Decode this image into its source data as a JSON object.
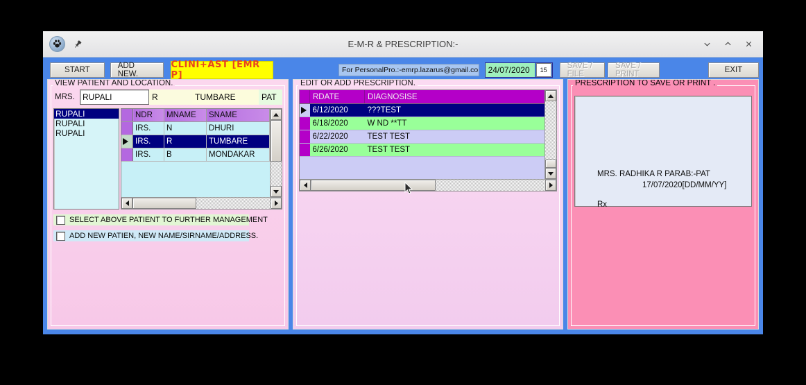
{
  "titlebar": {
    "title": "E-M-R & PRESCRIPTION:-",
    "app_icon": "paw-print-icon",
    "pin_icon": "pin-icon",
    "minimize_label": "⌄",
    "restore_label": "⌃",
    "close_label": "✕"
  },
  "toolbar": {
    "start_label": "START",
    "add_new_label": "ADD NEW.",
    "brand_label": "CLINI+AST [EMR P]",
    "brand_bg": "#ffff00",
    "brand_color": "#e8441d",
    "email_value": "For PersonalPro.:-emrp.lazarus@gmail.com",
    "date_value": "24/07/2020",
    "date_spin_value": "15",
    "save_file_label": "SAVE / FILE",
    "save_print_label": "SAVE / PRINT",
    "exit_label": "EXIT"
  },
  "left_panel": {
    "legend": "VIEW PATIENT AND LOCATION.",
    "name_prefix": "MRS.",
    "name_value": "RUPALI",
    "middle_initial": "R",
    "surname": "TUMBARE",
    "location": "PAT",
    "patient_list": [
      "RUPALI",
      "RUPALI",
      "RUPALI"
    ],
    "selected_list_index": 0,
    "grid_headers": [
      "NDR",
      "MNAME",
      "SNAME"
    ],
    "grid_rows": [
      {
        "gndr": "IRS.",
        "mname": "N",
        "sname": "DHURI",
        "selected": false
      },
      {
        "gndr": "IRS.",
        "mname": "R",
        "sname": "TUMBARE",
        "selected": true
      },
      {
        "gndr": "IRS.",
        "mname": "B",
        "sname": "MONDAKAR",
        "selected": false
      }
    ],
    "checkbox_1_label": "SELECT ABOVE PATIENT TO FURTHER MANAGEMENT",
    "checkbox_2_label": "ADD  NEW PATIEN, NEW NAME/SIRNAME/ADDRESS.",
    "checkbox_1_checked": false,
    "checkbox_2_checked": false
  },
  "mid_panel": {
    "legend": "EDIT OR ADD PRESCRIPTION.",
    "grid_headers": [
      "RDATE",
      "DIAGNOSISE"
    ],
    "grid_rows": [
      {
        "rdate": "6/12/2020",
        "diagnosise": "???TEST",
        "selected": true
      },
      {
        "rdate": "6/18/2020",
        "diagnosise": "W ND **TT",
        "selected": false
      },
      {
        "rdate": "6/22/2020",
        "diagnosise": "TEST TEST",
        "selected": false
      },
      {
        "rdate": "6/26/2020",
        "diagnosise": " TEST TEST",
        "selected": false
      }
    ]
  },
  "right_panel": {
    "legend": "PRESCRIPTION TO SAVE OR PRINT .",
    "preview_line_1": "MRS. RADHIKA  R  PARAB:-PAT",
    "preview_line_2": "17/07/2020[DD/MM/YY]",
    "preview_line_3": "Rx"
  },
  "colors": {
    "window_frame": "#4a86e8",
    "left_panel_bg": "#f8cfe9",
    "mid_panel_bg": "#f6d3ef",
    "right_panel_bg": "#fb8fb5",
    "grid_header": "#b400c8",
    "selection": "#000080"
  }
}
